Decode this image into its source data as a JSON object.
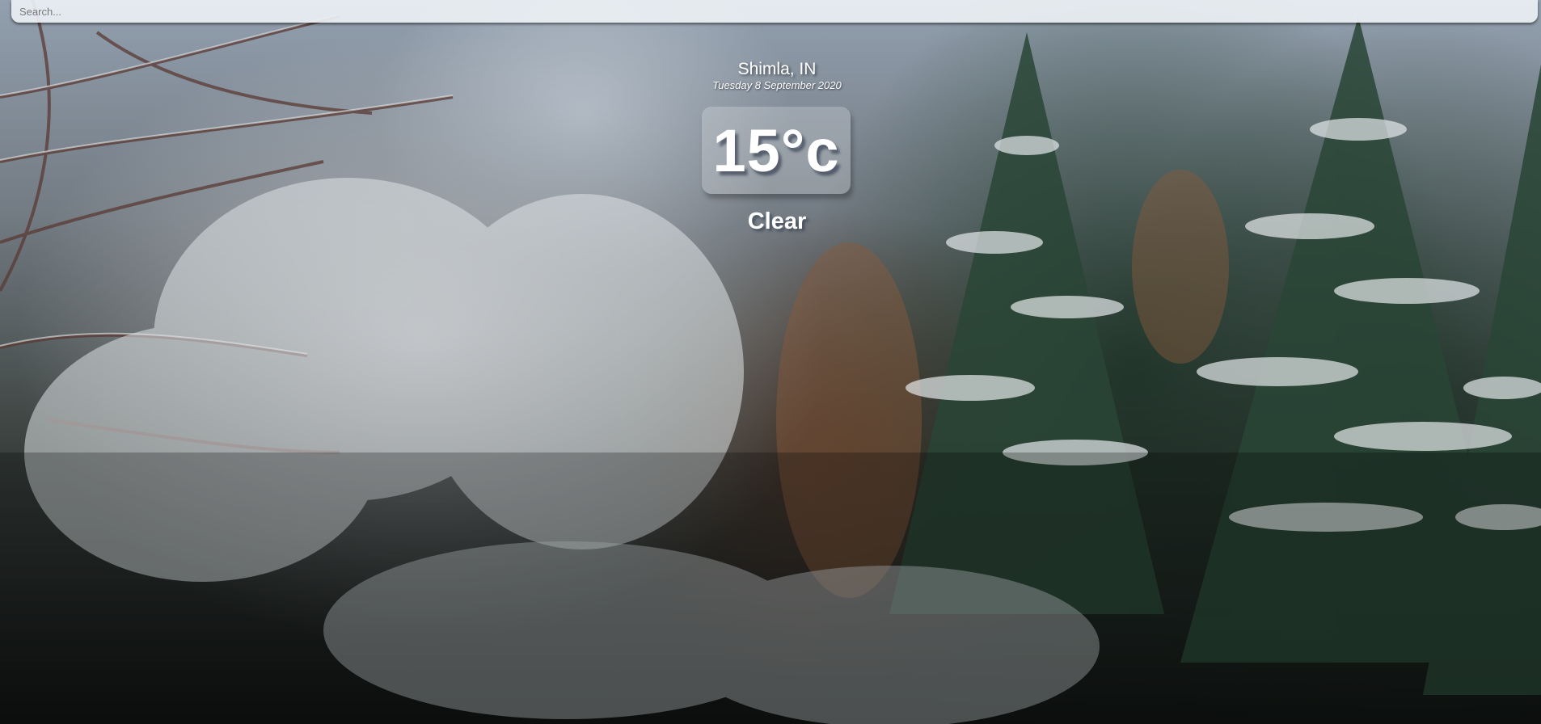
{
  "search": {
    "placeholder": "Search...",
    "value": ""
  },
  "location": {
    "city": "Shimla, IN",
    "date": "Tuesday 8 September 2020"
  },
  "weather": {
    "temperature": "15°c",
    "condition": "Clear"
  },
  "colors": {
    "text": "#ffffff",
    "search_bg": "#ecf0f4"
  }
}
